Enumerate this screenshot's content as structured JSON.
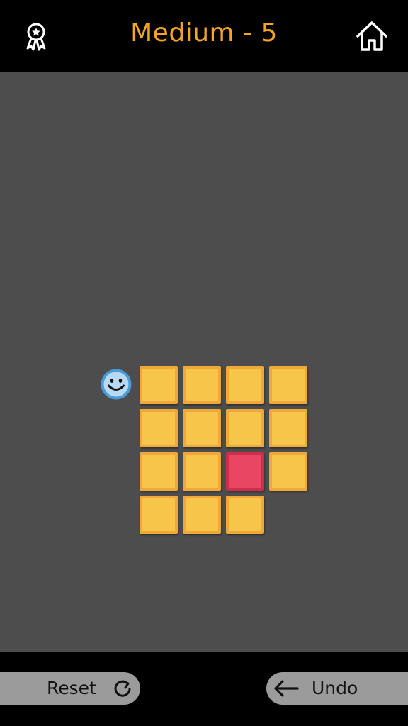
{
  "header": {
    "title": "Medium - 5",
    "award_icon": "award-ribbon-icon",
    "home_icon": "home-icon"
  },
  "board": {
    "player_icon": "smiley-face-icon",
    "grid": [
      [
        "tile",
        "tile",
        "tile",
        "tile"
      ],
      [
        "tile",
        "tile",
        "tile",
        "tile"
      ],
      [
        "tile",
        "tile",
        "target",
        "tile"
      ],
      [
        "tile",
        "tile",
        "tile",
        null
      ]
    ],
    "colors": {
      "tile": "#F7C54A",
      "tile_border": "#EFA83A",
      "target": "#E84663",
      "target_border": "#CF2E4B",
      "background": "#4D4D4D",
      "accent": "#F5A623"
    }
  },
  "footer": {
    "reset_label": "Reset",
    "reset_icon": "reset-circular-arrow-icon",
    "undo_label": "Undo",
    "undo_icon": "arrow-left-icon"
  }
}
